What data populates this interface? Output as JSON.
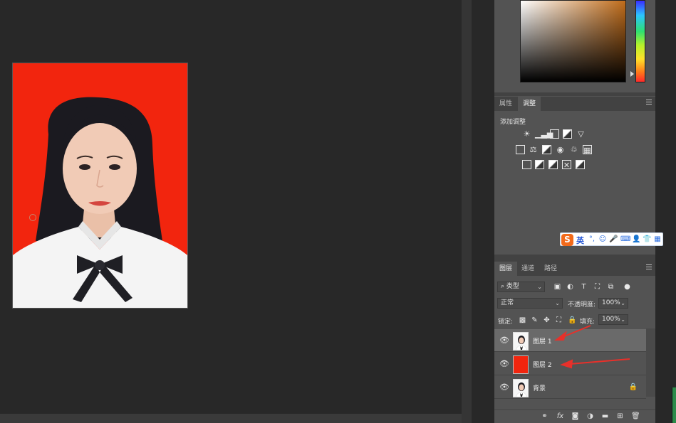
{
  "panels": {
    "properties_tabs": [
      {
        "label": "属性",
        "active": false
      },
      {
        "label": "调整",
        "active": true
      }
    ],
    "adjustments": {
      "title": "添加调整"
    },
    "layers_tabs": [
      {
        "label": "图层",
        "active": true
      },
      {
        "label": "通道",
        "active": false
      },
      {
        "label": "路径",
        "active": false
      }
    ],
    "layers": {
      "filter_kind": "类型",
      "blend_mode": "正常",
      "opacity_label": "不透明度:",
      "opacity_value": "100%",
      "lock_label": "锁定:",
      "fill_label": "填充:",
      "fill_value": "100%",
      "items": [
        {
          "name": "图层 1",
          "selected": true,
          "thumb": "portrait"
        },
        {
          "name": "图层 2",
          "selected": false,
          "thumb": "red-fill"
        },
        {
          "name": "背景",
          "selected": false,
          "thumb": "portrait",
          "locked": true
        }
      ]
    }
  },
  "ime_toolbar": {
    "logo": "S",
    "mode": "英"
  },
  "colors": {
    "photo_background": "#f2250e",
    "panel_bg": "#535353",
    "workspace_bg": "#282828",
    "annotation_arrow": "#e8302a",
    "ime_logo": "#f26a1b"
  }
}
